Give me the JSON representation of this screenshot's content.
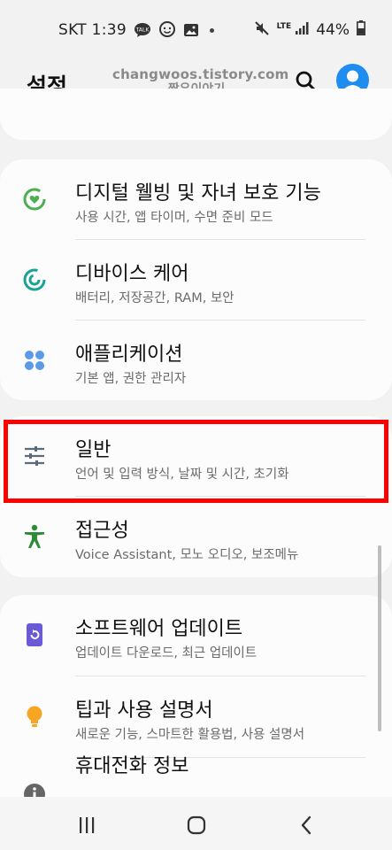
{
  "status_bar": {
    "carrier_time": "SKT 1:39",
    "network": "LTE",
    "battery": "44%"
  },
  "header": {
    "title": "설정",
    "watermark_line1": "changwoos.tistory.com",
    "watermark_line2": "짱우이야기"
  },
  "groups": [
    {
      "items": [
        {
          "title": "디지털 웰빙 및 자녀 보호 기능",
          "subtitle": "사용 시간, 앱 타이머, 수면 준비 모드",
          "icon": "digital-wellbeing-icon",
          "color": "#4caf50"
        },
        {
          "title": "디바이스 케어",
          "subtitle": "배터리, 저장공간, RAM, 보안",
          "icon": "device-care-icon",
          "color": "#1aa394"
        },
        {
          "title": "애플리케이션",
          "subtitle": "기본 앱, 권한 관리자",
          "icon": "apps-icon",
          "color": "#5b9be6"
        }
      ]
    },
    {
      "items": [
        {
          "title": "일반",
          "subtitle": "언어 및 입력 방식, 날짜 및 시간, 초기화",
          "icon": "sliders-icon",
          "color": "#5c6a7a",
          "highlighted": true
        },
        {
          "title": "접근성",
          "subtitle": "Voice Assistant, 모노 오디오, 보조메뉴",
          "icon": "accessibility-icon",
          "color": "#2e8b3a"
        }
      ]
    },
    {
      "items": [
        {
          "title": "소프트웨어 업데이트",
          "subtitle": "업데이트 다운로드, 최근 업데이트",
          "icon": "software-update-icon",
          "color": "#6a5ad6"
        },
        {
          "title": "팁과 사용 설명서",
          "subtitle": "새로운 기능, 스마트한 활용법, 사용 설명서",
          "icon": "lightbulb-icon",
          "color": "#f6a623"
        },
        {
          "title": "휴대전화 정보",
          "subtitle": "",
          "icon": "info-icon",
          "color": "#666666"
        }
      ]
    }
  ],
  "colors": {
    "background": "#f2f2f2",
    "card": "#fcfcfc",
    "highlight": "#ff0000",
    "avatar": "#1f8cf0"
  }
}
